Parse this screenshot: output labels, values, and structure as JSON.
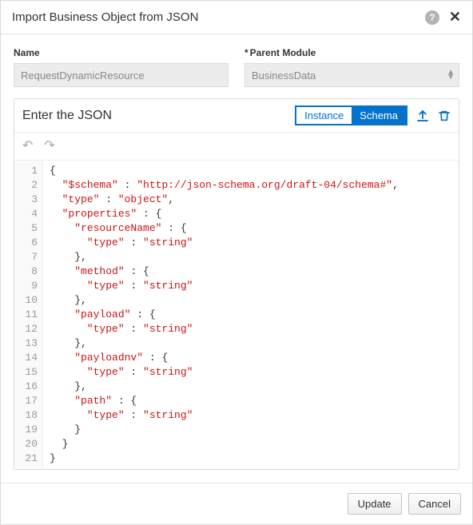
{
  "dialog": {
    "title": "Import Business Object from JSON"
  },
  "fields": {
    "name_label": "Name",
    "name_value": "RequestDynamicResource",
    "parent_label": "Parent Module",
    "parent_value": "BusinessData"
  },
  "editor": {
    "title": "Enter the JSON",
    "tabs": {
      "instance": "Instance",
      "schema": "Schema"
    }
  },
  "code": {
    "lines": [
      {
        "indent": 0,
        "t": "brace-open"
      },
      {
        "indent": 1,
        "k": "$schema",
        "v": "http://json-schema.org/draft-04/schema#",
        "comma": true
      },
      {
        "indent": 1,
        "k": "type",
        "v": "object",
        "comma": true
      },
      {
        "indent": 1,
        "k": "properties",
        "t": "obj-open"
      },
      {
        "indent": 2,
        "k": "resourceName",
        "t": "obj-open"
      },
      {
        "indent": 3,
        "k": "type",
        "v": "string"
      },
      {
        "indent": 2,
        "t": "brace-close",
        "comma": true
      },
      {
        "indent": 2,
        "k": "method",
        "t": "obj-open"
      },
      {
        "indent": 3,
        "k": "type",
        "v": "string"
      },
      {
        "indent": 2,
        "t": "brace-close",
        "comma": true
      },
      {
        "indent": 2,
        "k": "payload",
        "t": "obj-open"
      },
      {
        "indent": 3,
        "k": "type",
        "v": "string"
      },
      {
        "indent": 2,
        "t": "brace-close",
        "comma": true
      },
      {
        "indent": 2,
        "k": "payloadnv",
        "t": "obj-open"
      },
      {
        "indent": 3,
        "k": "type",
        "v": "string"
      },
      {
        "indent": 2,
        "t": "brace-close",
        "comma": true
      },
      {
        "indent": 2,
        "k": "path",
        "t": "obj-open"
      },
      {
        "indent": 3,
        "k": "type",
        "v": "string"
      },
      {
        "indent": 2,
        "t": "brace-close"
      },
      {
        "indent": 1,
        "t": "brace-close"
      },
      {
        "indent": 0,
        "t": "brace-close"
      }
    ]
  },
  "footer": {
    "update": "Update",
    "cancel": "Cancel"
  }
}
